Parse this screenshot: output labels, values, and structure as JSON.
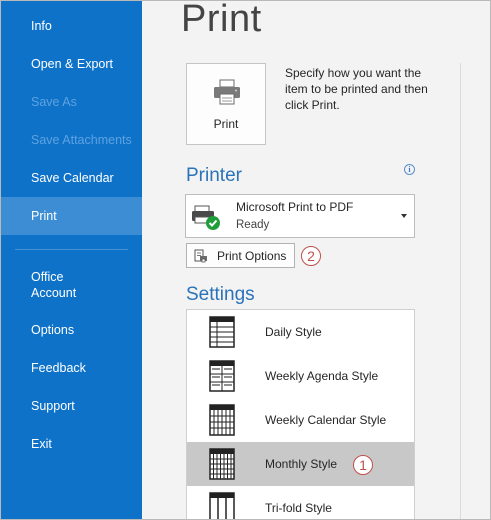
{
  "sidebar": {
    "items": [
      {
        "label": "Info",
        "state": "normal"
      },
      {
        "label": "Open & Export",
        "state": "normal"
      },
      {
        "label": "Save As",
        "state": "disabled"
      },
      {
        "label": "Save Attachments",
        "state": "disabled"
      },
      {
        "label": "Save Calendar",
        "state": "normal"
      },
      {
        "label": "Print",
        "state": "active"
      },
      {
        "label_line1": "Office",
        "label_line2": "Account",
        "state": "normal"
      },
      {
        "label": "Options",
        "state": "normal"
      },
      {
        "label": "Feedback",
        "state": "normal"
      },
      {
        "label": "Support",
        "state": "normal"
      },
      {
        "label": "Exit",
        "state": "normal"
      }
    ]
  },
  "main": {
    "title": "Print",
    "print_button": {
      "label": "Print",
      "icon": "printer-icon"
    },
    "print_description": "Specify how you want the item to be printed and then click Print.",
    "printer_heading": "Printer",
    "info_icon": "i",
    "printer": {
      "name": "Microsoft Print to PDF",
      "status": "Ready"
    },
    "print_options_label": "Print Options",
    "settings_heading": "Settings",
    "styles": [
      {
        "label": "Daily Style",
        "icon": "daily-style-icon"
      },
      {
        "label": "Weekly Agenda Style",
        "icon": "weekly-agenda-style-icon"
      },
      {
        "label": "Weekly Calendar Style",
        "icon": "weekly-calendar-style-icon"
      },
      {
        "label": "Monthly Style",
        "icon": "monthly-style-icon",
        "selected": true
      },
      {
        "label": "Tri-fold Style",
        "icon": "trifold-style-icon"
      }
    ]
  },
  "annotations": {
    "step1": "1",
    "step2": "2"
  },
  "colors": {
    "sidebar_bg": "#0e72c8",
    "sidebar_active": "#3c8dd4",
    "heading_blue": "#2b73b9",
    "badge_red": "#c0504d",
    "selected_row": "#c8c8c8"
  }
}
